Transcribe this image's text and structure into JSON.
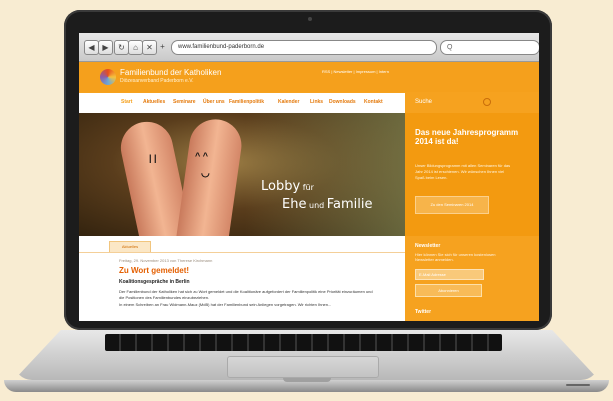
{
  "browser": {
    "back_label": "◀",
    "forward_label": "▶",
    "reload_label": "↻",
    "home_label": "⌂",
    "close_label": "✕",
    "add_label": "+",
    "url_value": "www.familienbund-paderborn.de",
    "search_label": "Q"
  },
  "site": {
    "logo_icon": "swirl-logo",
    "title": "Familienbund der Katholiken",
    "subtitle": "Diözesanverband Paderborn e.V.",
    "utility_links": "RSS  |  Newsletter  |  Impressum  |  Intern",
    "search_placeholder": "Suche",
    "search_icon": "magnifier-icon"
  },
  "nav": {
    "items": [
      {
        "label": "Start"
      },
      {
        "label": "Aktuelles"
      },
      {
        "label": "Seminare"
      },
      {
        "label": "Über uns"
      },
      {
        "label": "Familienpolitik"
      },
      {
        "label": "Kalender"
      },
      {
        "label": "Links"
      },
      {
        "label": "Downloads"
      },
      {
        "label": "Kontakt"
      }
    ]
  },
  "hero": {
    "line1_main": "Lobby",
    "line1_small": " für",
    "line2_main": "Ehe",
    "line2_small": " und ",
    "line2_end": "Familie"
  },
  "promo": {
    "title": "Das neue Jahresprogramm 2014 ist da!",
    "text": "Unser Bildungsprogramm mit allen Seminaren für das Jahr 2014 ist erschienen. Wir wünschen Ihnen viel Spaß beim Lesen.",
    "button_label": "Zu den Seminaren 2014"
  },
  "content": {
    "tab_label": "Aktuelles",
    "meta": "Freitag, 29. November 2013 von Therese Kirchmann",
    "headline": "Zu Wort gemeldet!",
    "subhead": "Koalitionsgespräche in Berlin",
    "body": "Der Familienbund der Katholiken hat sich zu Wort gemeldet und die Koalitionäre aufgefordert der Familienpolitik eine Priorität einzuräumen und die Positionen des Familienbundes einzubeziehen.",
    "body2": "In einem Schreiben an Frau Widmann-Mauz (MdB) hat der Familienbund sein Anliegen vorgetragen. Wir richten Ihnen..."
  },
  "sidebar": {
    "newsletter_title": "Newsletter",
    "newsletter_text": "Hier können Sie sich für unseren kostenlosen Newsletter anmelden.",
    "email_placeholder": "E-Mail Adresse",
    "subscribe_label": "Abonnieren",
    "twitter_title": "Twitter"
  }
}
